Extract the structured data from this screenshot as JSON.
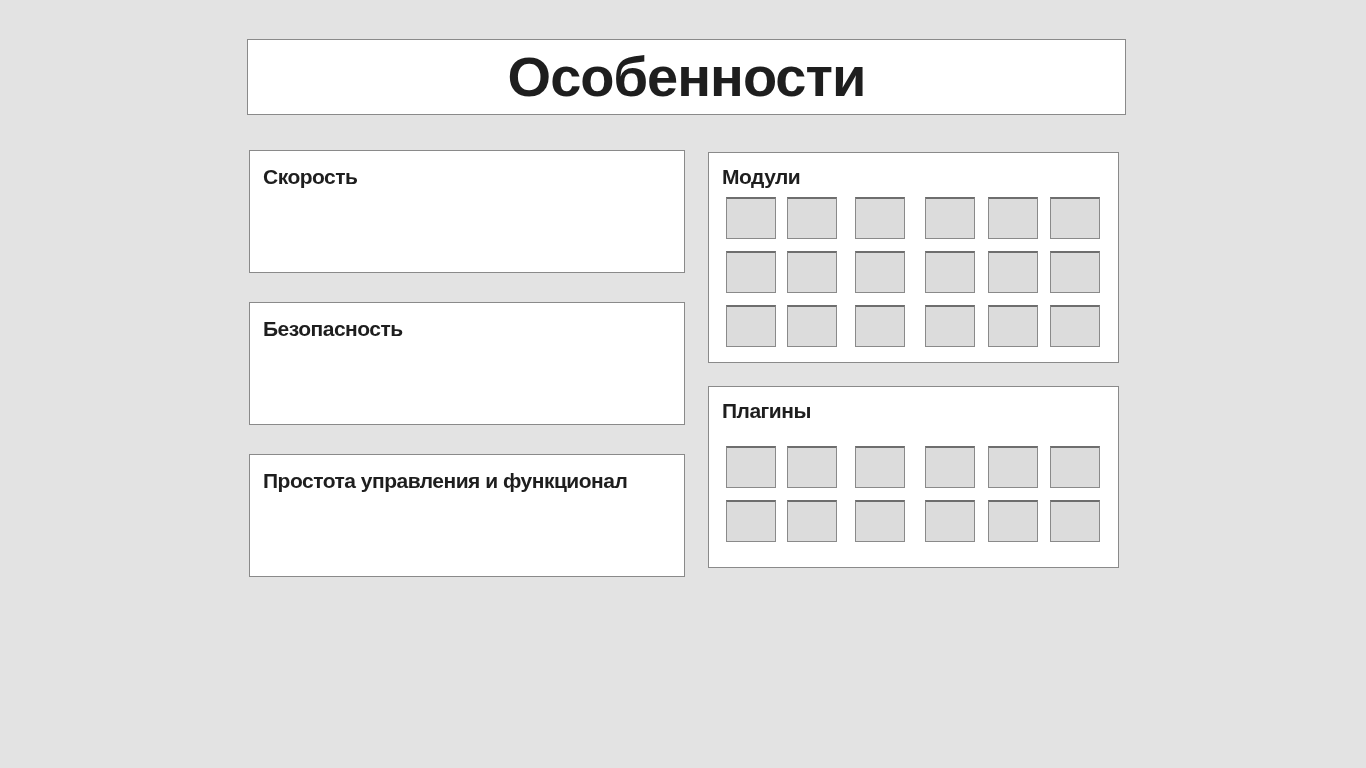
{
  "title": "Особенности",
  "left_cards": [
    {
      "heading": "Скорость"
    },
    {
      "heading": "Безопасность"
    },
    {
      "heading": "Простота управления и функционал"
    }
  ],
  "right_cards": [
    {
      "heading": "Модули",
      "kind": "modules"
    },
    {
      "heading": "Плагины",
      "kind": "plugins"
    }
  ]
}
